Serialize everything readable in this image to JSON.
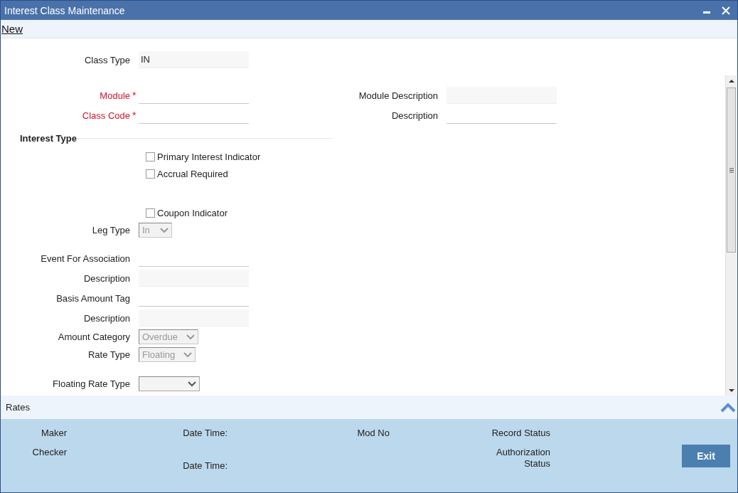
{
  "window": {
    "title": "Interest Class Maintenance"
  },
  "toolbar": {
    "items": [
      {
        "label": "New"
      }
    ]
  },
  "form": {
    "header_fields": [
      {
        "label": "Class Type",
        "kind": "readonly",
        "value": "IN"
      }
    ],
    "key_fields_left": [
      {
        "label": "Module",
        "kind": "text",
        "required": true,
        "mark": "*"
      },
      {
        "label": "Class Code",
        "kind": "text",
        "required": true,
        "mark": "*"
      }
    ],
    "key_fields_right": [
      {
        "label": "Module Description",
        "kind": "readonly"
      },
      {
        "label": "Description",
        "kind": "text"
      }
    ],
    "section_title": "Interest Type",
    "groups": [
      [
        {
          "label": "Primary Interest Indicator",
          "kind": "checkbox",
          "checked": false
        },
        {
          "label": "Accrual Required",
          "kind": "checkbox",
          "checked": false
        }
      ],
      [
        {
          "label": "Coupon Indicator",
          "kind": "checkbox",
          "checked": false
        },
        {
          "label": "Leg Type",
          "kind": "select",
          "value": "In",
          "disabled": true
        }
      ],
      [
        {
          "label": "Event For Association",
          "kind": "text"
        },
        {
          "label": "Description",
          "kind": "readonly"
        },
        {
          "label": "Basis Amount Tag",
          "kind": "text"
        },
        {
          "label": "Description",
          "kind": "readonly"
        },
        {
          "label": "Amount Category",
          "kind": "select",
          "value": "Overdue",
          "disabled": true
        },
        {
          "label": "Rate Type",
          "kind": "select",
          "value": "Floating",
          "disabled": true
        }
      ],
      [
        {
          "label": "Floating Rate Type",
          "kind": "select",
          "disabled": false
        }
      ]
    ]
  },
  "rates_bar": {
    "label": "Rates"
  },
  "footer": {
    "columns": [
      [
        "Maker",
        "Checker"
      ],
      [
        "Date Time:",
        "Date Time:"
      ],
      [
        "Mod No"
      ],
      [
        "Record Status",
        "Authorization Status"
      ]
    ],
    "exit_button": "Exit"
  }
}
